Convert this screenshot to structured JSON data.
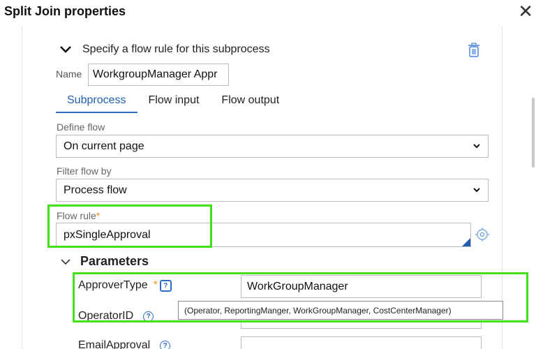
{
  "dialog": {
    "title": "Split Join properties",
    "close_icon": "close-icon"
  },
  "section": {
    "title": "Specify a flow rule for this subprocess",
    "expand_icon": "chevron-down-icon",
    "delete_icon": "trash-icon"
  },
  "name": {
    "label": "Name",
    "value": "WorkgroupManager Appr"
  },
  "tabs": [
    {
      "label": "Subprocess",
      "active": true
    },
    {
      "label": "Flow input",
      "active": false
    },
    {
      "label": "Flow output",
      "active": false
    }
  ],
  "define_flow": {
    "label": "Define flow",
    "value": "On current page"
  },
  "filter_flow": {
    "label": "Filter flow by",
    "value": "Process flow"
  },
  "flow_rule": {
    "label": "Flow rule",
    "required_mark": "*",
    "value": "pxSingleApproval",
    "target_icon": "target-icon"
  },
  "parameters": {
    "title": "Parameters",
    "items": [
      {
        "label": "ApproverType",
        "required_mark": "*",
        "help": "?",
        "value": "WorkGroupManager"
      },
      {
        "label": "OperatorID",
        "help": "?",
        "value": ""
      },
      {
        "label": "EmailApproval",
        "help": "?",
        "value": ""
      }
    ]
  },
  "tooltip": {
    "text": "(Operator, ReportingManger, WorkGroupManager, CostCenterManager)"
  },
  "colors": {
    "accent": "#2c6cc8",
    "required": "#f09a1a",
    "highlight": "#44e01a"
  }
}
